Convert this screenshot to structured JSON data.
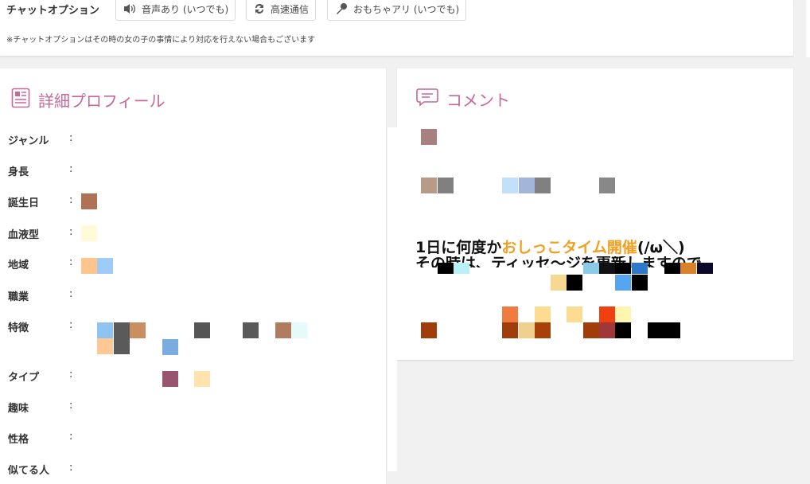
{
  "chat_options": {
    "title": "チャットオプション",
    "options": [
      {
        "label": "音声あり (いつでも)",
        "icon": "speaker-icon"
      },
      {
        "label": "高速通信",
        "icon": "refresh-icon"
      },
      {
        "label": "おもちゃアリ (いつでも)",
        "icon": "microphone-icon"
      }
    ],
    "note": "※チャットオプションはその時の女の子の事情により対応を行えない場合もございます"
  },
  "profile": {
    "title": "詳細プロフィール",
    "icon": "profile-document-icon",
    "colon": ":",
    "rows": [
      {
        "label": "ジャンル"
      },
      {
        "label": "身長"
      },
      {
        "label": "誕生日"
      },
      {
        "label": "血液型"
      },
      {
        "label": "地域"
      },
      {
        "label": "職業"
      },
      {
        "label": "特徴"
      },
      {
        "label": "タイプ"
      },
      {
        "label": "趣味"
      },
      {
        "label": "性格"
      },
      {
        "label": "似てる人"
      }
    ]
  },
  "comment": {
    "title": "コメント",
    "icon": "comment-bubble-icon",
    "line1_pre": "1日に何度か",
    "line1_highlight": "おしっこタイム開催",
    "line1_post": "(/ω＼)",
    "line2": "その時は、ティッセ〜ジを更新しますので"
  },
  "colors": {
    "accent": "#c8679a",
    "highlight": "#f0a020"
  }
}
